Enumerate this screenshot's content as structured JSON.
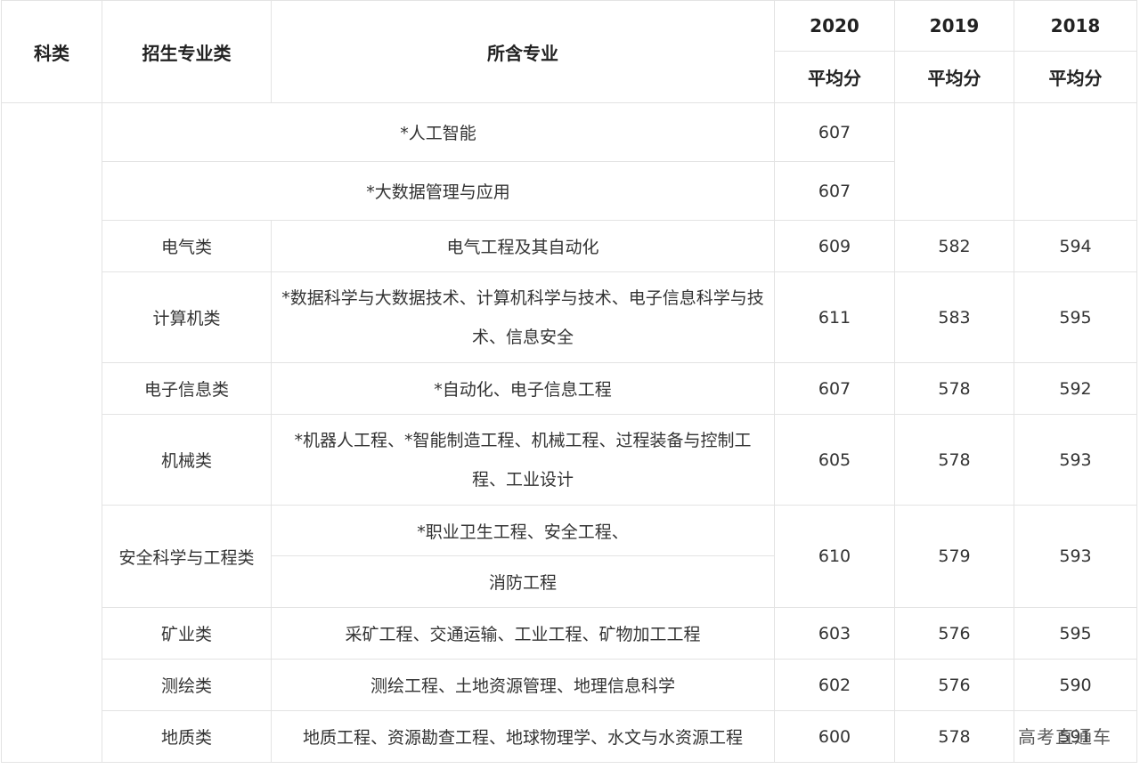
{
  "header": {
    "col_subject": "科类",
    "col_category": "招生专业类",
    "col_majors": "所含专业",
    "years": [
      "2020",
      "2019",
      "2018"
    ],
    "avg_label": "平均分"
  },
  "rows": [
    {
      "category": "",
      "majors": "*人工智能",
      "s2020": "607",
      "s2019": "",
      "s2018": ""
    },
    {
      "category": "",
      "majors": "*大数据管理与应用",
      "s2020": "607",
      "s2019": "",
      "s2018": ""
    },
    {
      "category": "电气类",
      "majors": "电气工程及其自动化",
      "s2020": "609",
      "s2019": "582",
      "s2018": "594"
    },
    {
      "category": "计算机类",
      "majors": "*数据科学与大数据技术、计算机科学与技术、电子信息科学与技术、信息安全",
      "s2020": "611",
      "s2019": "583",
      "s2018": "595"
    },
    {
      "category": "电子信息类",
      "majors": "*自动化、电子信息工程",
      "s2020": "607",
      "s2019": "578",
      "s2018": "592"
    },
    {
      "category": "机械类",
      "majors": "*机器人工程、*智能制造工程、机械工程、过程装备与控制工程、工业设计",
      "s2020": "605",
      "s2019": "578",
      "s2018": "593"
    },
    {
      "category": "安全科学与工程类",
      "majors_line1": "*职业卫生工程、安全工程、",
      "majors_line2": "消防工程",
      "s2020": "610",
      "s2019": "579",
      "s2018": "593"
    },
    {
      "category": "矿业类",
      "majors": "采矿工程、交通运输、工业工程、矿物加工工程",
      "s2020": "603",
      "s2019": "576",
      "s2018": "595"
    },
    {
      "category": "测绘类",
      "majors": "测绘工程、土地资源管理、地理信息科学",
      "s2020": "602",
      "s2019": "576",
      "s2018": "590"
    },
    {
      "category": "地质类",
      "majors": "地质工程、资源勘查工程、地球物理学、水文与水资源工程",
      "s2020": "600",
      "s2019": "578",
      "s2018": "591"
    }
  ],
  "watermark": "高考直通车"
}
